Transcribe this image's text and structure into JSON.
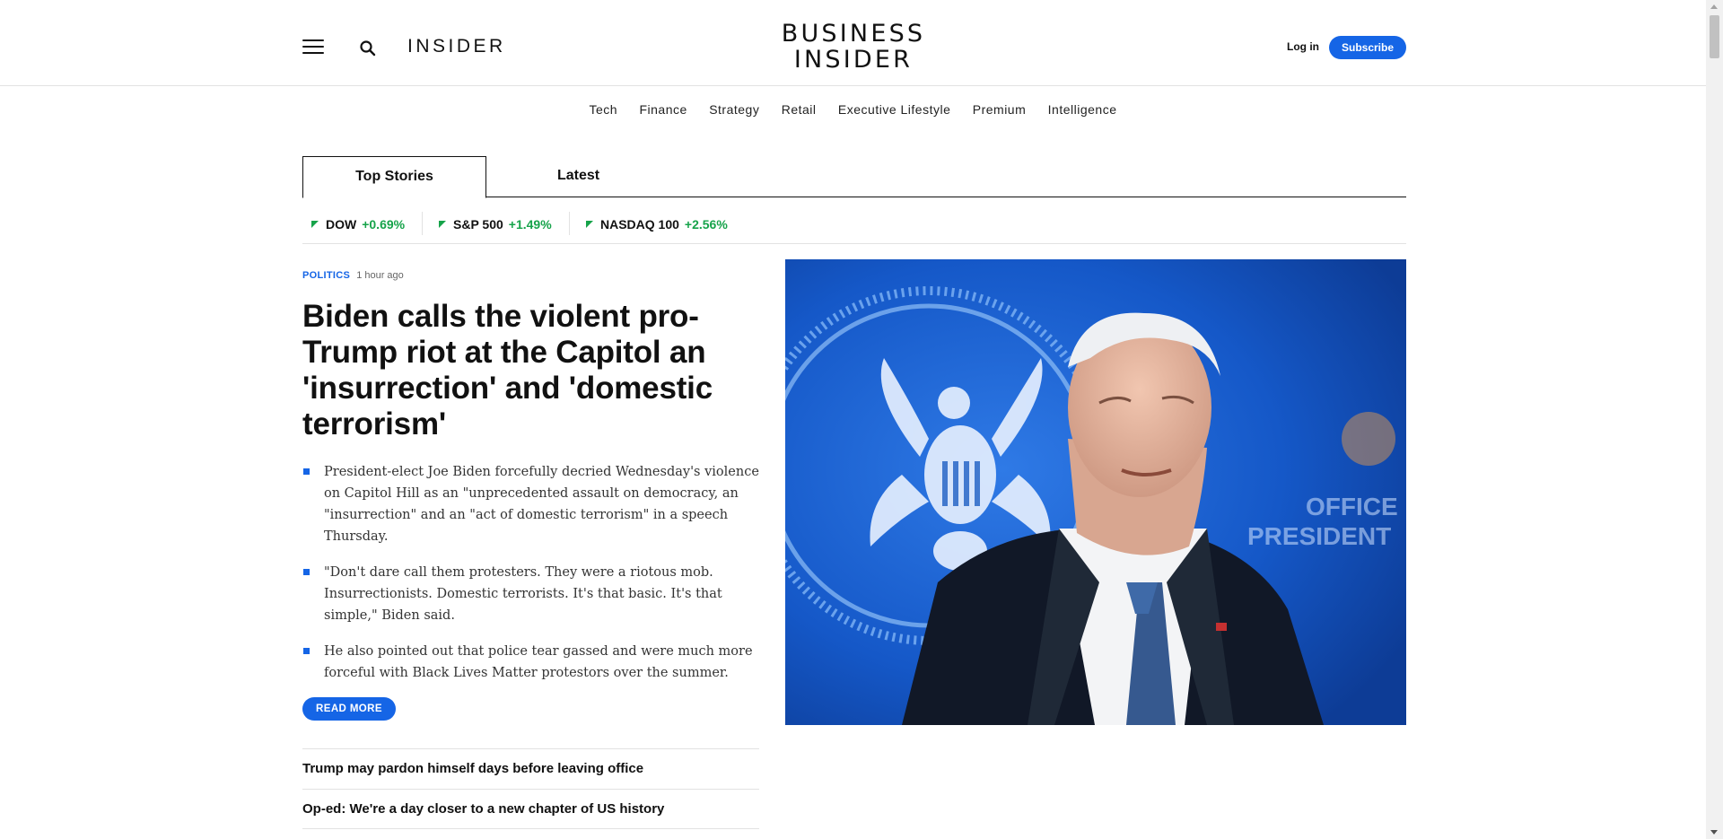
{
  "header": {
    "insider_label": "INSIDER",
    "logo_line1": "BUSINESS",
    "logo_line2": "INSIDER",
    "login_label": "Log in",
    "subscribe_label": "Subscribe"
  },
  "nav": {
    "items": [
      "Tech",
      "Finance",
      "Strategy",
      "Retail",
      "Executive Lifestyle",
      "Premium",
      "Intelligence"
    ]
  },
  "tabs": [
    {
      "label": "Top Stories",
      "active": true
    },
    {
      "label": "Latest",
      "active": false
    }
  ],
  "markets": [
    {
      "name": "DOW",
      "change": "+0.69%"
    },
    {
      "name": "S&P 500",
      "change": "+1.49%"
    },
    {
      "name": "NASDAQ 100",
      "change": "+2.56%"
    }
  ],
  "story": {
    "category": "POLITICS",
    "time": "1 hour ago",
    "headline": "Biden calls the violent pro-Trump riot at the Capitol an 'insurrection' and 'domestic terrorism'",
    "bullets": [
      "President-elect Joe Biden forcefully decried Wednesday's violence on Capitol Hill as an \"unprecedented assault on democracy, an \"insurrection\" and an \"act of domestic terrorism\" in a speech Thursday.",
      "\"Don't dare call them protesters. They were a riotous mob. Insurrectionists. Domestic terrorists. It's that basic. It's that simple,\" Biden said.",
      "He also pointed out that police tear gassed and were much more forceful with Black Lives Matter protestors over the summer."
    ],
    "read_more_label": "READ MORE",
    "hero_seal_text": [
      "OFFICE",
      "PRESIDENT"
    ]
  },
  "related": [
    "Trump may pardon himself days before leaving office",
    "Op-ed: We're a day closer to a new chapter of US history"
  ],
  "colors": {
    "accent": "#1565e6",
    "gain": "#16a34a"
  }
}
